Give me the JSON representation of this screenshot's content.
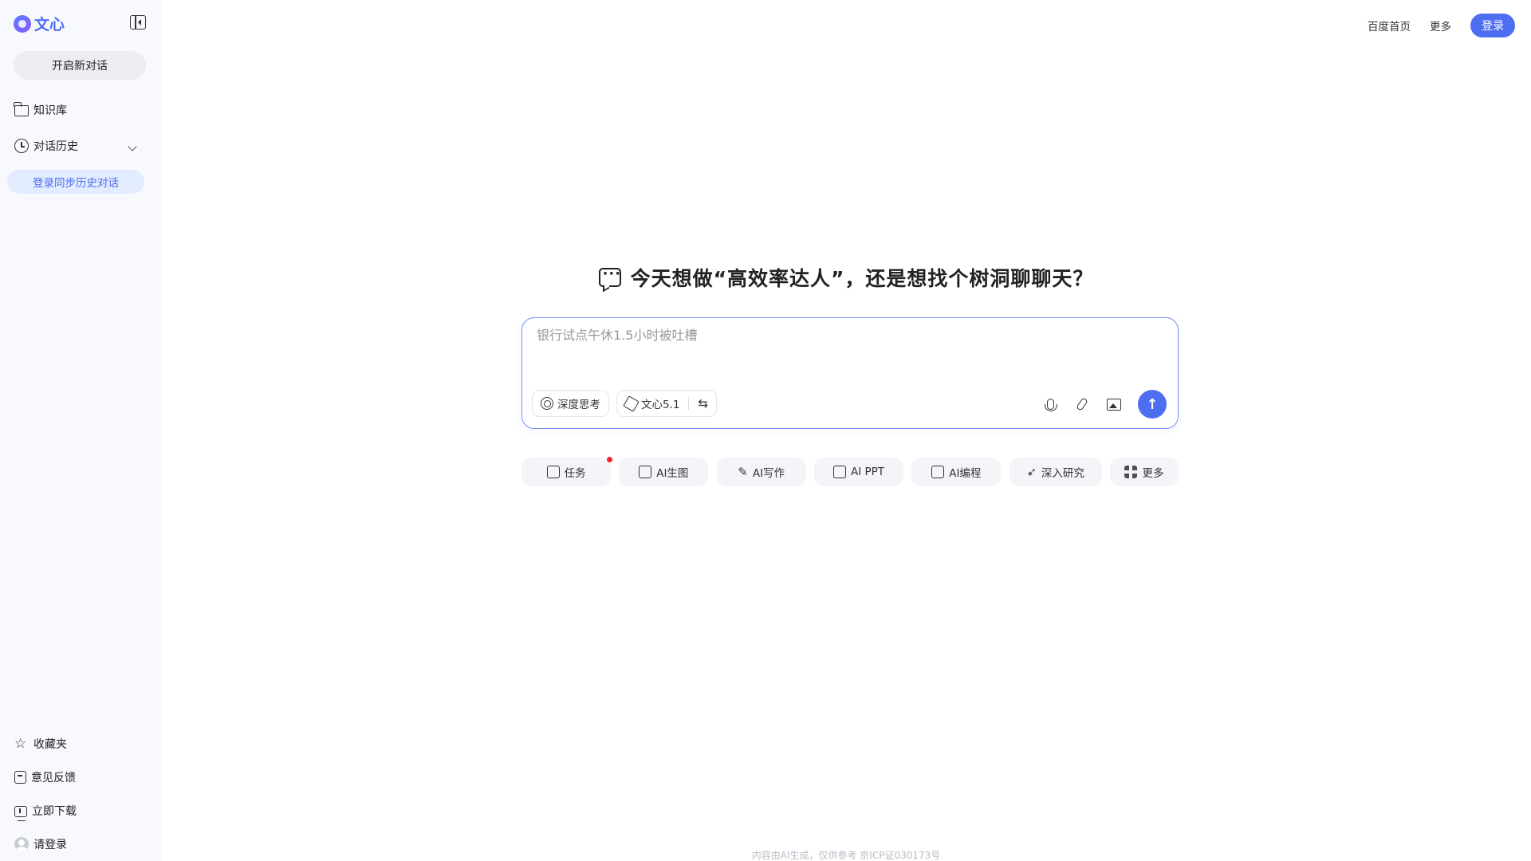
{
  "app": {
    "brand": "文心"
  },
  "sidebar": {
    "new_chat": "开启新对话",
    "items": [
      {
        "label": "知识库"
      },
      {
        "label": "对话历史"
      }
    ],
    "login_sync": "登录同步历史对话",
    "bottom": [
      {
        "label": "收藏夹"
      },
      {
        "label": "意见反馈"
      },
      {
        "label": "立即下载"
      },
      {
        "label": "请登录"
      }
    ]
  },
  "topbar": {
    "home": "百度首页",
    "more": "更多",
    "login": "登录"
  },
  "main": {
    "headline": "今天想做“高效率达人”，还是想找个树洞聊聊天？",
    "input": {
      "placeholder": "银行试点午休1.5小时被吐槽",
      "deep_think": "深度思考",
      "model": "文心5.1"
    },
    "chips": [
      {
        "label": "任务",
        "badge": true
      },
      {
        "label": "AI生图"
      },
      {
        "label": "AI写作"
      },
      {
        "label": "AI PPT"
      },
      {
        "label": "AI编程"
      },
      {
        "label": "深入研究"
      },
      {
        "label": "更多"
      }
    ]
  },
  "footer": "内容由AI生成，仅供参考  京ICP证030173号",
  "colors": {
    "accent": "#4e6ef2",
    "badge": "#f5222d",
    "sidebar_bg": "#f8f9fd"
  }
}
